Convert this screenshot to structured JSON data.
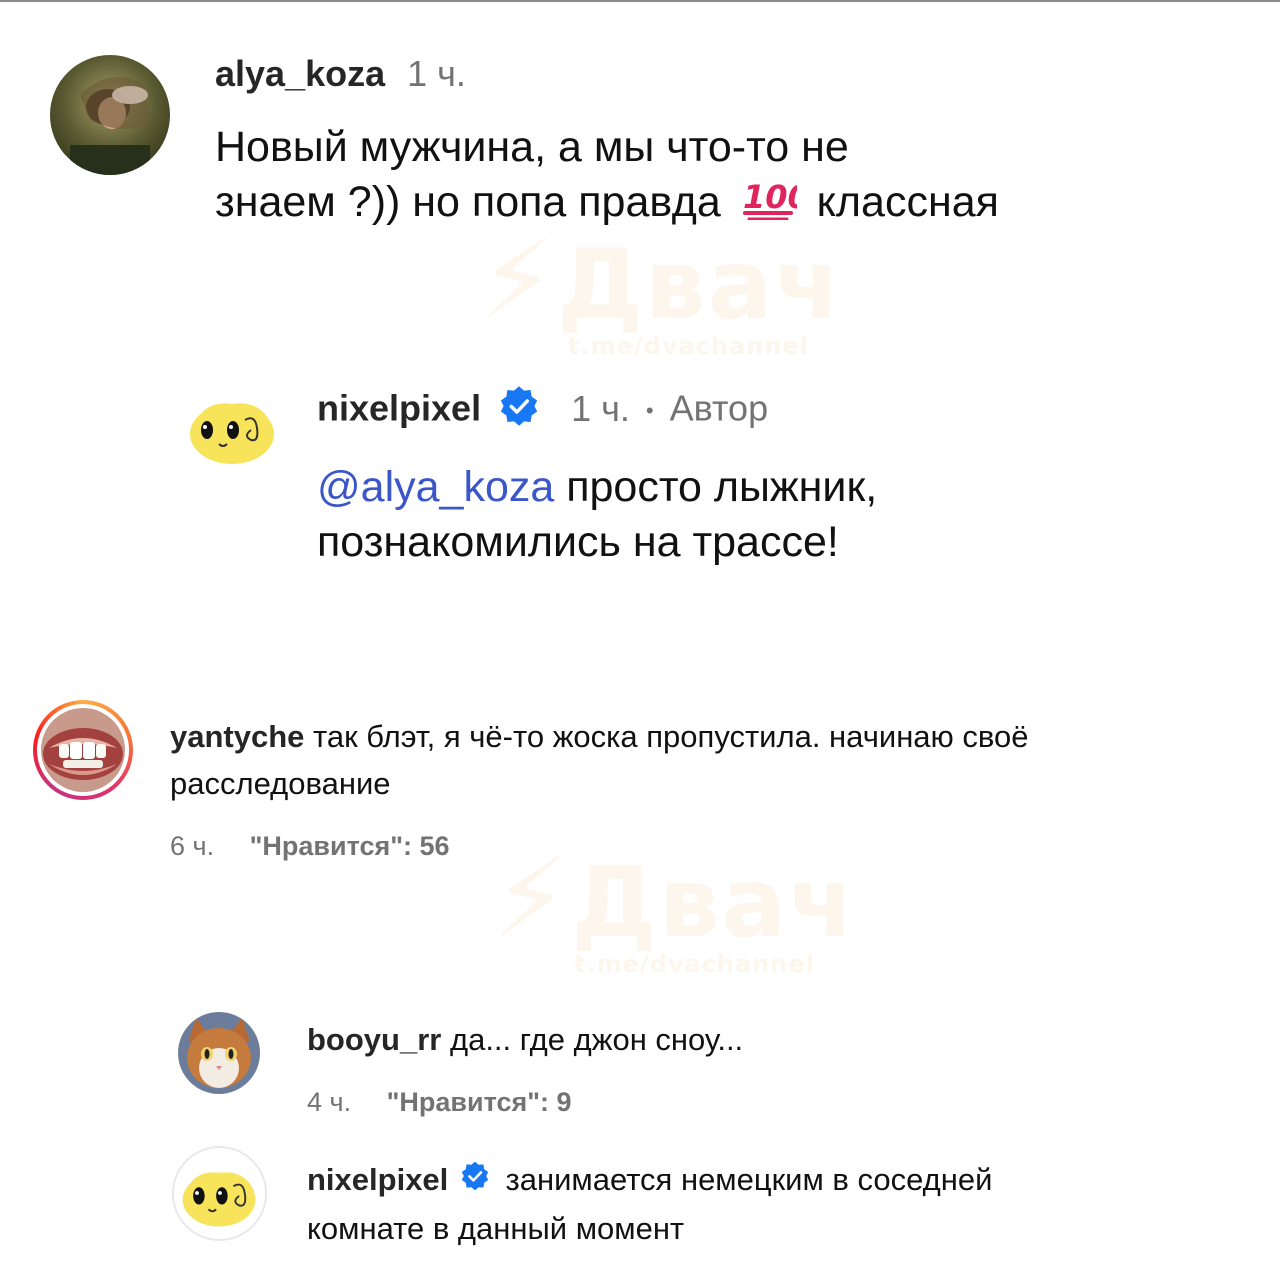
{
  "watermark": {
    "brand": "Двач",
    "handle": "t.me/dvachannel"
  },
  "comments": [
    {
      "username": "alya_koza",
      "time": "1 ч.",
      "text_line1": "Новый мужчина, а мы что-то не",
      "text_line2_prefix": "знаем ?)) но попа правда",
      "emoji": "💯",
      "text_line2_suffix": "классная"
    },
    {
      "username": "nixelpixel",
      "time": "1 ч.",
      "separator": "•",
      "author_label": "Автор",
      "mention": "@alya_koza",
      "text_line1": "просто лыжник,",
      "text_line2": "познакомились на трассе!"
    },
    {
      "username": "yantyche",
      "text_line1": "так блэт, я чё-то жоска пропустила. начинаю своё",
      "text_line2": "расследование",
      "time": "6 ч.",
      "likes": "\"Нравится\": 56"
    },
    {
      "username": "booyu_rr",
      "text": "да... где джон сноу...",
      "time": "4 ч.",
      "likes": "\"Нравится\": 9"
    },
    {
      "username": "nixelpixel",
      "text_line1": "занимается немецким в соседней",
      "text_line2": "комнате в данный момент"
    }
  ],
  "colors": {
    "verified": "#1877f2",
    "mention": "#3b56c8",
    "meta": "#737373",
    "story_ring": "#e1306c",
    "avatar_yellow": "#f7e45a"
  },
  "icons": {
    "verified": "verified-badge-icon",
    "emoji": "hundred-points-icon"
  }
}
